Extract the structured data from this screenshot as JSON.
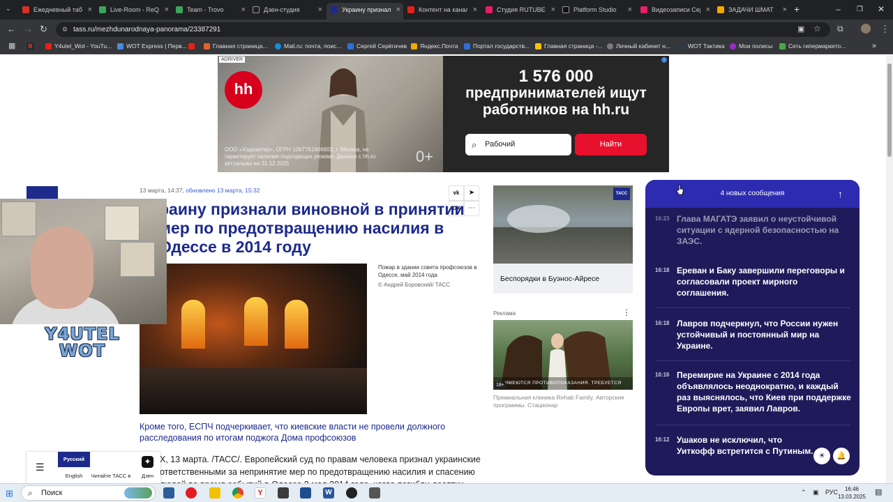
{
  "browser": {
    "tabs": [
      {
        "label": "Ежедневный таб",
        "color": "#d93025"
      },
      {
        "label": "Live-Room - ReQ",
        "color": "#3ba55c"
      },
      {
        "label": "Team - Trovo",
        "color": "#3ba55c"
      },
      {
        "label": "Дзен-студия",
        "color": "#222222"
      },
      {
        "label": "Украину признал",
        "color": "#1e2a8c"
      },
      {
        "label": "Контент на канал",
        "color": "#e62117"
      },
      {
        "label": "Студия RUTUBE",
        "color": "#e91e63"
      },
      {
        "label": "Platform Studio",
        "color": "#111111"
      },
      {
        "label": "Видеозаписи Сер",
        "color": "#e91e63"
      },
      {
        "label": "ЗАДАЧИ ШМАТ",
        "color": "#f2a900"
      }
    ],
    "url": "tass.ru/mezhdunarodnaya-panorama/23387291",
    "bookmarks": [
      {
        "label": "Y4utel_Wot - YouTu...",
        "color": "#e62117"
      },
      {
        "label": "WOT Express | Перв...",
        "color": "#4a8cd8"
      },
      {
        "label": "",
        "color": "#e62117"
      },
      {
        "label": "Главная страница...",
        "color": "#e2622a"
      },
      {
        "label": "Mail.ru: почта, поис...",
        "color": "#168de2"
      },
      {
        "label": "Сергей Серёгичев",
        "color": "#2e6fd8"
      },
      {
        "label": "Яндекс.Почта",
        "color": "#f2a900"
      },
      {
        "label": "Портал государств...",
        "color": "#2e6fd8"
      },
      {
        "label": "Главная страница -...",
        "color": "#f2c200"
      },
      {
        "label": "Личный кабинет н...",
        "color": "#7a7a7a"
      },
      {
        "label": "WOT Тактика",
        "color": "#2e3a44"
      },
      {
        "label": "Мои полисы",
        "color": "#9b2cc9"
      },
      {
        "label": "Сеть гипермаркето...",
        "color": "#4aa84a"
      }
    ]
  },
  "ad": {
    "adriver": "ADRIVER",
    "brand": "hh",
    "headline_big": "1 576 000",
    "headline_rest": "предпринимателей ищут работников на hh.ru",
    "search_value": "Рабочий",
    "button": "Найти",
    "legal": "ООО «Хэдхантер», ОГРН 1067761906603, г. Москва, не гарантирует наличие подходящих резюме. Данные с hh.ru актуальны на 31.12.2025",
    "age": "0+"
  },
  "article": {
    "date": "13 марта, 14:37,",
    "updated": "обновлено 13 марта, 15:32",
    "headline": "раину признали виновной в принятии мер по предотвращению насилия в Одессе в 2014 году",
    "caption": "Пожар в здании совета профсоюзов в Одессе, май 2014 года",
    "caption_copy": "© Андрей Боровский/ ТАСС",
    "lead": "Кроме того, ЕСПЧ подчеркивает, что киевские власти не провели должного расследования по итогам поджога Дома профсоюзов",
    "body": "Х, 13 марта. /ТАСС/. Европейский суд по правам человека признал украинские ответственными за непринятие мер по предотвращению насилия и спасению людей во время событий в Одессе 2 мая 2014 года, когда погибли десятки"
  },
  "side": {
    "news_title": "Беспорядки в Буэнос-Айресе",
    "tass_badge": "ТАСС",
    "ad_label": "Реклама",
    "ad_warning": "ИМЕЮТСЯ ПРОТИВОПОКАЗАНИЯ. ТРЕБУЕТСЯ КОНСУЛЬТАЦИЯ СПЕЦИАЛИСТА",
    "ad_age": "18+",
    "ad_text": "Премиальная клиника Rehab Family. Авторские программы. Стационар"
  },
  "ticker": {
    "new_messages": "4 новых сообщения",
    "items": [
      {
        "time": "16:23",
        "text": "Глава МАГАТЭ заявил о неустойчивой ситуации с ядерной безопасностью на ЗАЭС."
      },
      {
        "time": "16:18",
        "text": "Ереван и Баку завершили переговоры и согласовали проект мирного соглашения."
      },
      {
        "time": "16:18",
        "text": "Лавров подчеркнул, что России нужен устойчивый и постоянный мир на Украине."
      },
      {
        "time": "16:16",
        "text": "Перемирие на Украине с 2014 года объявлялось неоднократно, и каждый раз выяснялось, что Киев при поддержке Европы врет, заявил Лавров."
      },
      {
        "time": "16:12",
        "text": "Ушаков не исключил, что Уиткофф встретится с Путиным."
      }
    ]
  },
  "bottombar": {
    "lang_ru": "Русский",
    "lang_en": "English",
    "read_tass": "Читайте ТАСС в",
    "dzen": "Дзен"
  },
  "overlay": {
    "logo_line1": "Y4UTEL",
    "logo_line2": "WOT"
  },
  "taskbar": {
    "search": "Поиск",
    "lang": "РУС",
    "time": "16:46",
    "date": "13.03.2025"
  }
}
